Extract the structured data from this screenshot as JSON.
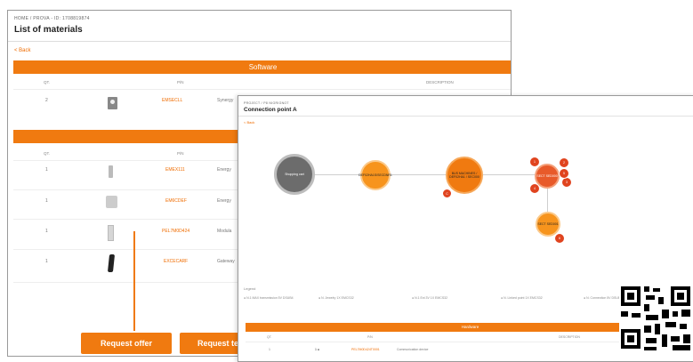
{
  "window1": {
    "breadcrumb": "HOME / PROVA - ID: 1708819874",
    "title": "List of materials",
    "back": "< Back",
    "software": {
      "label": "Software",
      "headers": [
        "QT.",
        "P/N",
        "DESCRIPTION"
      ],
      "rows": [
        {
          "qty": "2",
          "pn": "EMSECLL",
          "desc": "Synergy"
        }
      ]
    },
    "hardware": {
      "headers": [
        "QT.",
        "P/N"
      ],
      "rows": [
        {
          "qty": "1",
          "pn": "EMEX111",
          "desc": "Energy"
        },
        {
          "qty": "1",
          "pn": "EM6CDEF",
          "desc": "Energy"
        },
        {
          "qty": "1",
          "pn": "PEL7M0D424",
          "desc": "Modula"
        },
        {
          "qty": "1",
          "pn": "EXCECARF",
          "desc": "Gateway"
        }
      ]
    },
    "buttons": {
      "offer": "Request offer",
      "second": "Request te"
    }
  },
  "window2": {
    "breadcrumb": "PROJECT / P8 NIGRIGNOT",
    "title": "Connection point A",
    "back": "< Back",
    "nodes": {
      "grey": "Shopping cart",
      "orange1": "DEF02HA1S/SECDNR1",
      "orange2": "BUS MACHINES / DEF02HA1 / SEC000",
      "red1": "SECT SED000",
      "red2": "SECT SED001"
    },
    "badges": [
      "C",
      "1",
      "2",
      "3",
      "4",
      "5",
      "6",
      "7",
      "8"
    ],
    "legend_title": "Legend",
    "legend": [
      "● N.1 MAX transmission 5V DSUB4",
      "● N. Jewelry  1X EMCS32",
      "● N.1 Ext  3V 1X EMCS32",
      "● N. Linked point 1X EMCS32",
      "● N. Connection  5V DSUB4"
    ],
    "hardware_label": "Hardware",
    "hw_headers": [
      "QT.",
      "P/N",
      "DESCRIPTION"
    ],
    "hw_row": {
      "qty": "1",
      "sel": "1 ●",
      "pn": "PEL7M0D424T0001",
      "desc": "Communication device"
    }
  },
  "colors": {
    "accent": "#f07a10",
    "badge": "#e0441f"
  }
}
